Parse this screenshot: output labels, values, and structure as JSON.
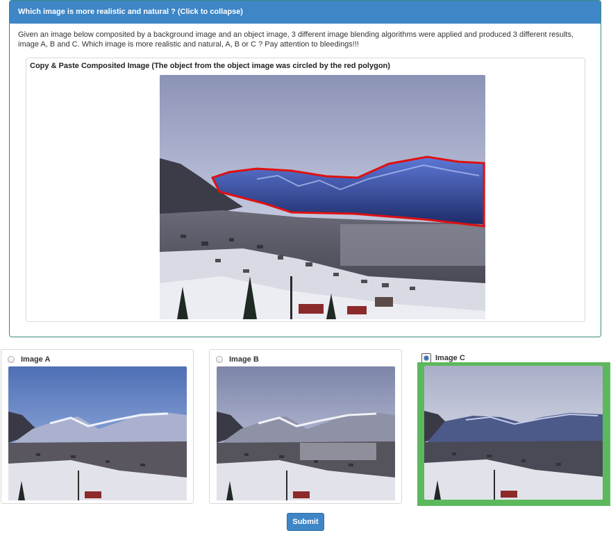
{
  "question": {
    "title": "Which image is more realistic and natural ? (Click to collapse)",
    "instructions": "Given an image below composited by a background image and an object image, 3 different image blending algorithms were applied and produced 3 different results, image A, B and C. Which image is more realistic and natural, A, B or C ? Pay attention to bleedings!!!",
    "composite_title": "Copy & Paste Composited Image (The object from the object image was circled by the red polygon)"
  },
  "options": [
    {
      "label": "Image A",
      "selected": false
    },
    {
      "label": "Image B",
      "selected": false
    },
    {
      "label": "Image C",
      "selected": true
    }
  ],
  "submit_label": "Submit",
  "colors": {
    "header_blue": "#3e86c6",
    "selected_green": "#5cb85c",
    "polygon_red": "#e01010"
  }
}
